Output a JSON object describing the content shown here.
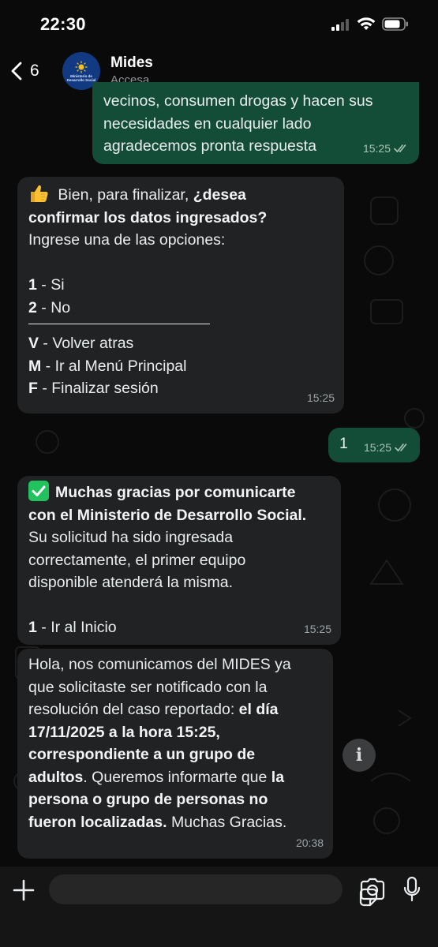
{
  "status_bar": {
    "time": "22:30"
  },
  "header": {
    "back_count": "6",
    "contact_name": "Mides",
    "contact_status": "Accesa",
    "avatar_text": "Ministerio de Desarrollo Social"
  },
  "messages": [
    {
      "direction": "outgoing",
      "lines": [
        "vecinos, consumen drogas y hacen sus",
        "necesidades en cualquier lado",
        "agradecemos pronta respuesta"
      ],
      "time": "15:25",
      "read": true
    },
    {
      "direction": "incoming",
      "line1_a": " Bien, para finalizar, ",
      "line1_b": "¿desea",
      "line2": "confirmar los datos ingresados?",
      "line3": "Ingrese una de las opciones:",
      "options": [
        {
          "key": "1",
          "text": " - Si"
        },
        {
          "key": "2",
          "text": " - No"
        }
      ],
      "nav_options": [
        {
          "key": "V",
          "text": " - Volver atras"
        },
        {
          "key": "M",
          "text": " - Ir al Menú Principal"
        },
        {
          "key": "F",
          "text": "  - Finalizar sesión"
        }
      ],
      "time": "15:25"
    },
    {
      "direction": "outgoing",
      "text": "1",
      "time": "15:25",
      "read": true
    },
    {
      "direction": "incoming",
      "bold_line1": "Muchas gracias por comunicarte",
      "bold_line2": "con el Ministerio de Desarrollo Social.",
      "lines": [
        "Su solicitud ha sido ingresada",
        "correctamente, el primer equipo",
        "disponible atenderá la misma."
      ],
      "option_key": "1",
      "option_text": " - Ir al Inicio",
      "time": "15:25"
    },
    {
      "direction": "incoming",
      "l1": "Hola, nos comunicamos del MIDES ya",
      "l2": "que solicitaste ser notificado con la",
      "l3a": "resolución del caso reportado: ",
      "l3b": "el día",
      "l4": "17/11/2025 a la hora 15:25,",
      "l5": "correspondiente a un grupo de",
      "l6a": "adultos",
      "l6b": ". Queremos informarte que ",
      "l6c": "la",
      "l7": "persona o grupo de personas no",
      "l8a": "fueron localizadas.",
      "l8b": " Muchas Gracias.",
      "time": "20:38"
    }
  ],
  "info_button": {
    "label": "i"
  },
  "colors": {
    "outgoing_bubble": "#144d37",
    "incoming_bubble": "#202223",
    "background": "#0a0a0a",
    "accent_green": "#22c35e"
  },
  "icons": [
    "back-chevron-icon",
    "signal-icon",
    "wifi-icon",
    "battery-icon",
    "thumbs-up-icon",
    "check-mark-icon",
    "double-check-icon",
    "info-icon",
    "plus-icon",
    "sticker-icon",
    "camera-icon",
    "microphone-icon"
  ]
}
